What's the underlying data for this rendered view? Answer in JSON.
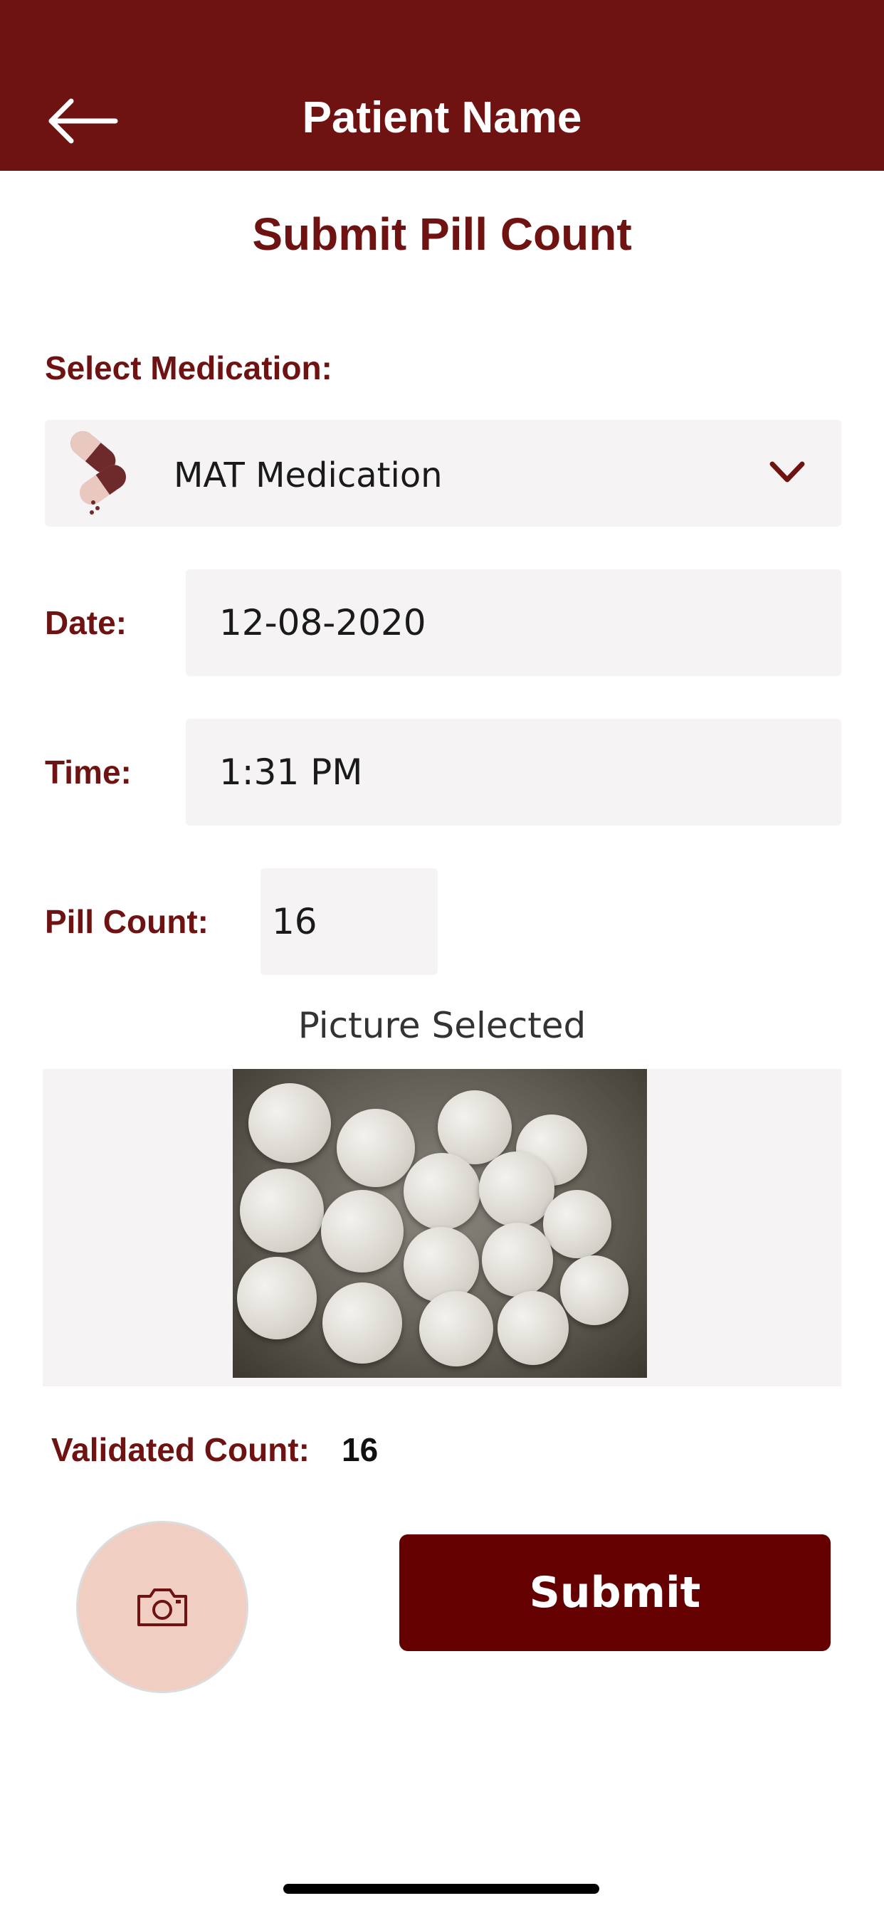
{
  "header": {
    "title": "Patient Name",
    "back_icon": "arrow-left-icon",
    "background": "#6e1212"
  },
  "page": {
    "title": "Submit Pill Count"
  },
  "medication": {
    "label": "Select Medication:",
    "selected": "MAT Medication",
    "icon": "pills-icon"
  },
  "date": {
    "label": "Date:",
    "value": "12-08-2020"
  },
  "time": {
    "label": "Time:",
    "value": "1:31  PM"
  },
  "pill_count": {
    "label": "Pill Count:",
    "value": "16"
  },
  "picture": {
    "caption": "Picture Selected"
  },
  "validated": {
    "label": "Validated Count:",
    "value": "16"
  },
  "actions": {
    "camera_icon": "camera-icon",
    "submit_label": "Submit",
    "accent": "#650000",
    "camera_bg": "#f0cfc2"
  }
}
